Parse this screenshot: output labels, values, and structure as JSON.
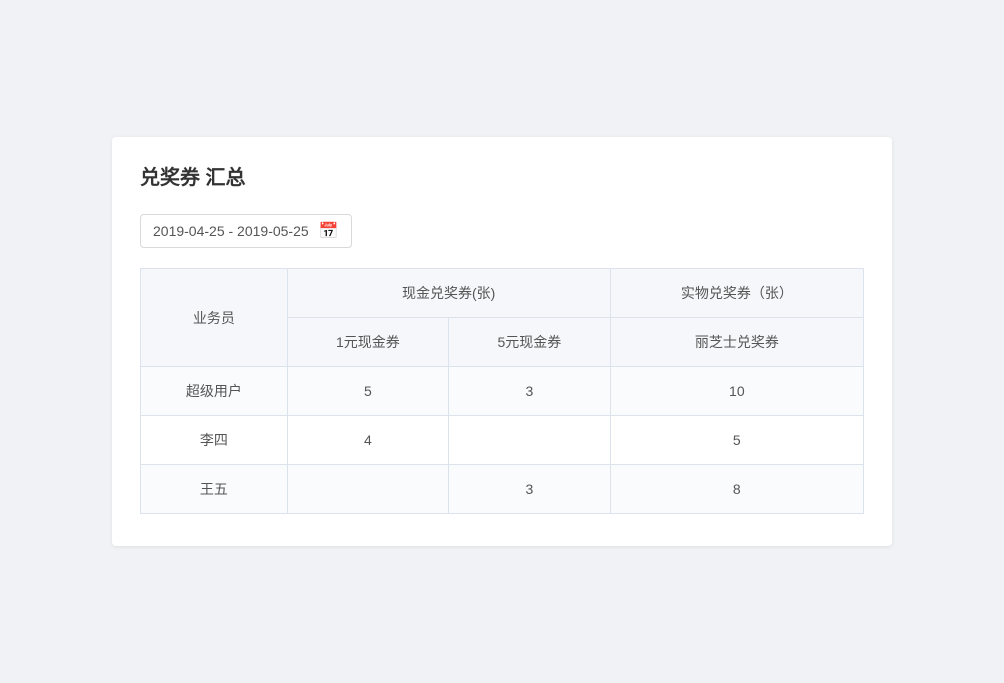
{
  "page": {
    "title": "兑奖券 汇总",
    "date_range": "2019-04-25 - 2019-05-25",
    "calendar_icon": "📅"
  },
  "table": {
    "col_agent": "业务员",
    "col_cash_group": "现金兑奖券(张)",
    "col_physical_group": "实物兑奖券（张）",
    "col_1yuan": "1元现金券",
    "col_5yuan": "5元现金券",
    "col_lizhi": "丽芝士兑奖券",
    "rows": [
      {
        "agent": "超级用户",
        "v1yuan": "5",
        "v5yuan": "3",
        "vlizhi": "10"
      },
      {
        "agent": "李四",
        "v1yuan": "4",
        "v5yuan": "",
        "vlizhi": "5"
      },
      {
        "agent": "王五",
        "v1yuan": "",
        "v5yuan": "3",
        "vlizhi": "8"
      }
    ]
  }
}
